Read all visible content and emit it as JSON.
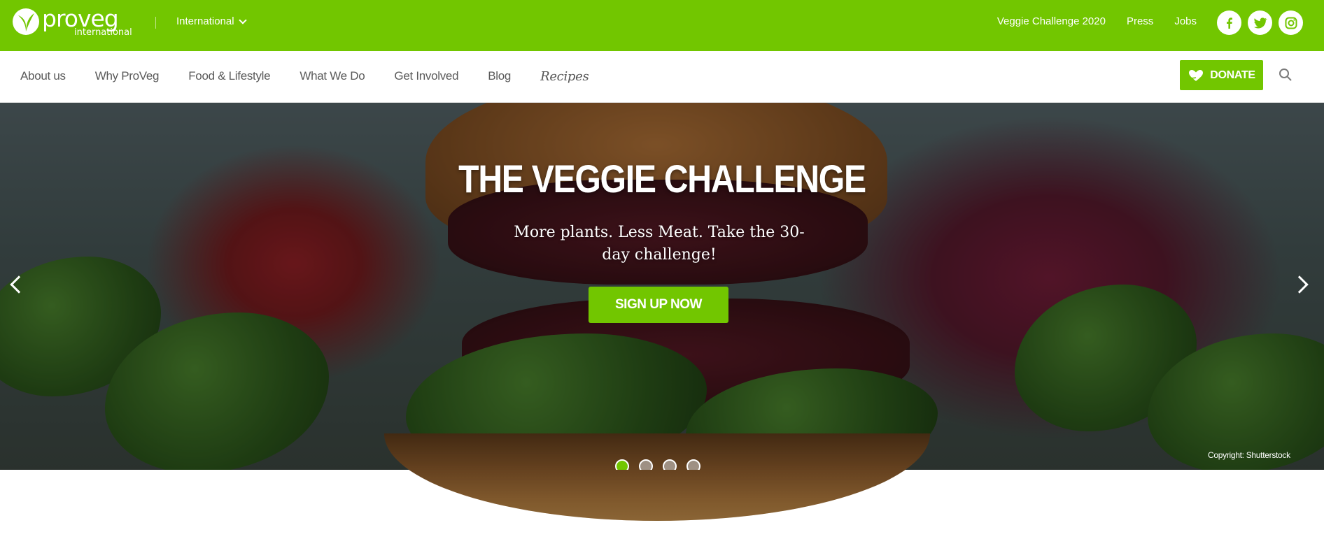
{
  "brand": {
    "name": "proveg",
    "subtitle": "international",
    "accent_color": "#72c600"
  },
  "topbar": {
    "region_label": "International",
    "links": [
      "Veggie Challenge 2020",
      "Press",
      "Jobs"
    ],
    "social_icons": [
      "facebook-icon",
      "twitter-icon",
      "instagram-icon"
    ]
  },
  "nav": {
    "items": [
      "About us",
      "Why ProVeg",
      "Food & Lifestyle",
      "What We Do",
      "Get Involved",
      "Blog",
      "Recipes"
    ],
    "donate_label": "DONATE"
  },
  "hero": {
    "title": "THE VEGGIE CHALLENGE",
    "subtitle": "More plants. Less Meat. Take the 30-day challenge!",
    "cta_label": "SIGN UP NOW",
    "credit": "Copyright: Shutterstock",
    "slides_total": 4,
    "active_slide": 1
  }
}
